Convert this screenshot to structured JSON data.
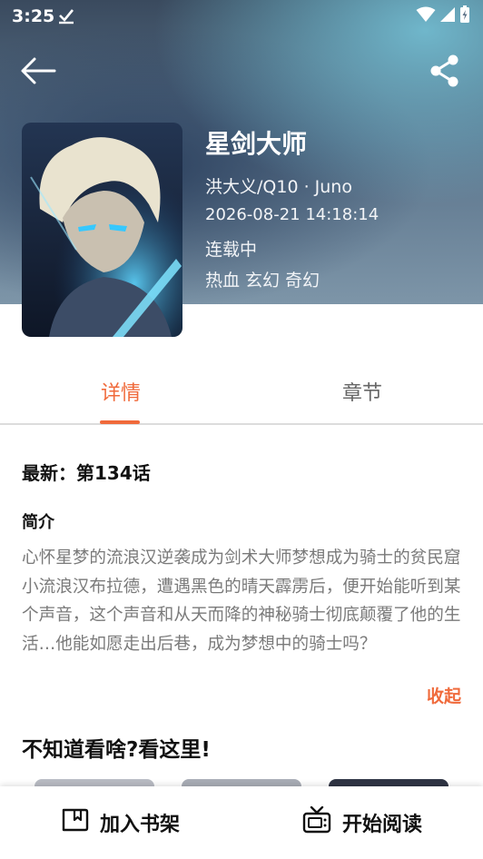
{
  "status_bar": {
    "time": "3:25"
  },
  "book": {
    "title": "星剑大师",
    "author": "洪大义/Q10 · Juno",
    "updated": "2026-08-21 14:18:14",
    "status": "连载中",
    "genres": [
      "热血",
      "玄幻",
      "奇幻"
    ]
  },
  "tabs": {
    "details": "详情",
    "chapters": "章节"
  },
  "details": {
    "latest": "最新：第134话",
    "intro_label": "简介",
    "intro_text": "心怀星梦的流浪汉逆袭成为剑术大师梦想成为骑士的贫民窟小流浪汉布拉德，遭遇黑色的晴天霹雳后，便开始能听到某个声音，这个声音和从天而降的神秘骑士彻底颠覆了他的生活…他能如愿走出后巷，成为梦想中的骑士吗？",
    "collapse_label": "收起",
    "recommend_title": "不知道看啥?看这里!"
  },
  "bottom_bar": {
    "add_shelf": "加入书架",
    "start_reading": "开始阅读"
  },
  "colors": {
    "accent": "#f06a3b",
    "text_dark": "#111111",
    "text_muted": "#7a7a7a"
  },
  "icons": {
    "back": "arrow-left-icon",
    "share": "share-icon",
    "shelf": "bookmark-book-icon",
    "read": "tv-icon",
    "wifi": "wifi-icon",
    "signal": "cell-signal-icon",
    "battery": "battery-icon",
    "download": "download-done-icon"
  }
}
